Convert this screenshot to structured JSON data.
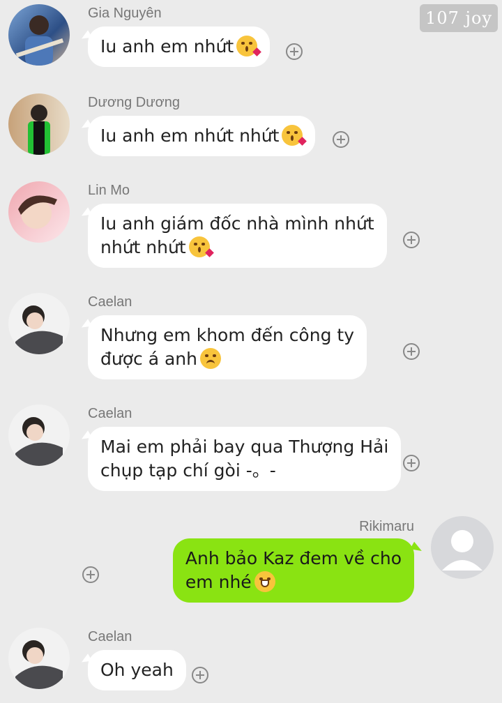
{
  "watermark": "107 joy",
  "messages": [
    {
      "sender": "Gia Nguyên",
      "text": "Iu anh em nhứt",
      "emoji": "kissing-face-heart"
    },
    {
      "sender": "Dương Dương",
      "text": "Iu anh em nhứt nhứt",
      "emoji": "kissing-face-heart"
    },
    {
      "sender": "Lin Mo",
      "text": "Iu anh giám đốc nhà mình nhứt\nnhứt nhứt",
      "emoji": "kissing-face-heart"
    },
    {
      "sender": "Caelan",
      "text": "Nhưng em khom đến công ty\nđược á anh",
      "emoji": "weary-face"
    },
    {
      "sender": "Caelan",
      "text": "Mai em phải bay qua Thượng Hải\nchụp tạp chí gòi -。-",
      "emoji": ""
    },
    {
      "sender": "Rikimaru",
      "text": "Anh bảo Kaz đem về cho\nem nhé",
      "emoji": "grinning-face"
    },
    {
      "sender": "Caelan",
      "text": "Oh yeah",
      "emoji": ""
    }
  ],
  "colors": {
    "background": "#ebebeb",
    "bubble_incoming": "#ffffff",
    "bubble_outgoing": "#8ae312"
  }
}
